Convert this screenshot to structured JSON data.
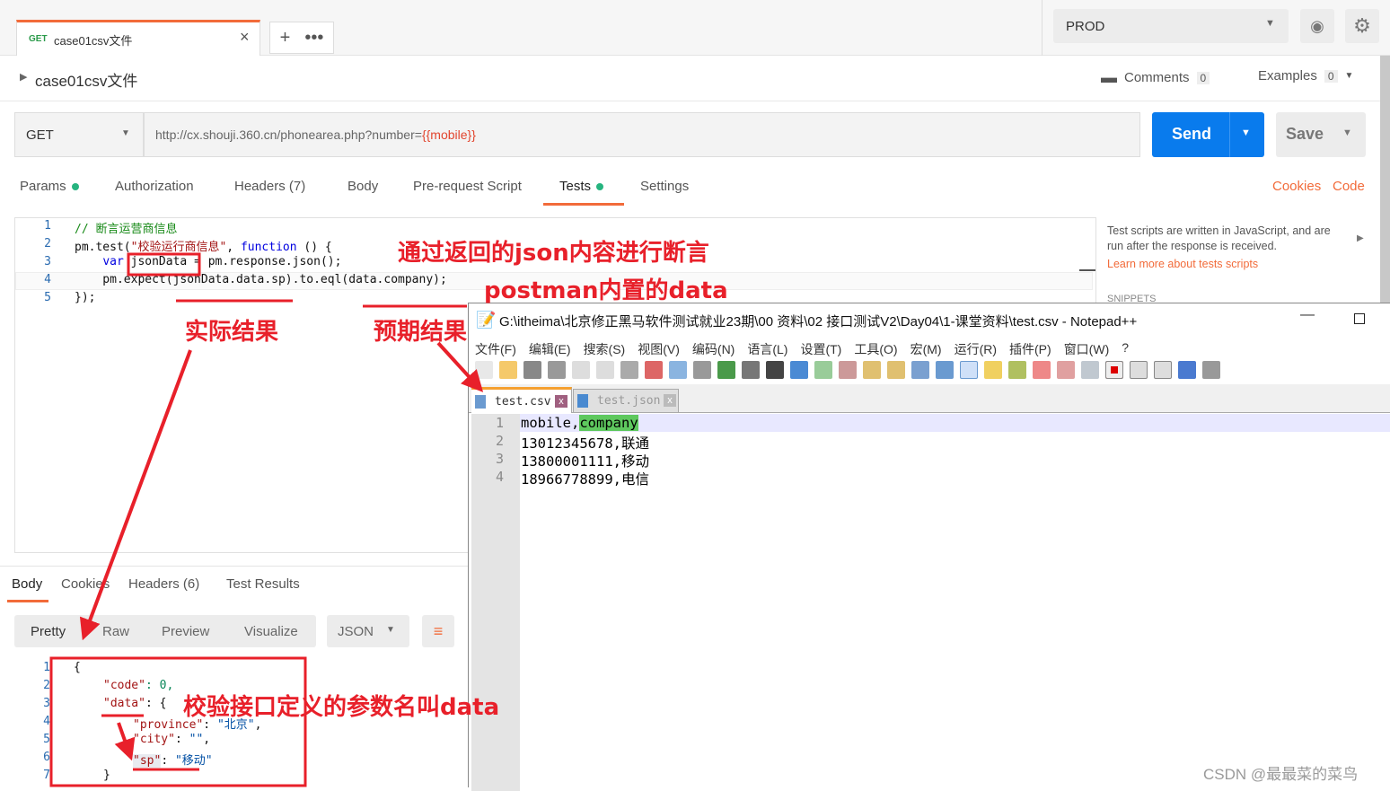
{
  "postman": {
    "request_tab": {
      "method": "GET",
      "name": "case01csv文件"
    },
    "environment": "PROD",
    "breadcrumb": "case01csv文件",
    "comments": {
      "label": "Comments",
      "count": "0"
    },
    "examples": {
      "label": "Examples",
      "count": "0"
    },
    "method": "GET",
    "url_prefix": "http://cx.shouji.360.cn/phonearea.php?number=",
    "url_var": "{{mobile}}",
    "send": "Send",
    "save": "Save",
    "tabs": [
      "Params",
      "Authorization",
      "Headers (7)",
      "Body",
      "Pre-request Script",
      "Tests",
      "Settings"
    ],
    "cookies": "Cookies",
    "code_link": "Code",
    "script_lines": [
      {
        "n": "1",
        "text": "// 断言运营商信息"
      },
      {
        "n": "2",
        "a": "pm.test(",
        "b": "\"校验运行商信息\"",
        "c": ", ",
        "d": "function",
        "e": " () {"
      },
      {
        "n": "3",
        "a": "    ",
        "b": "var",
        "c": " ",
        "d": "jsonData",
        "e": " = pm.response.json();"
      },
      {
        "n": "4",
        "text": "    pm.expect(jsonData.data.sp).to.eql(data.company);"
      },
      {
        "n": "5",
        "text": "});"
      }
    ],
    "side_help": "Test scripts are written in JavaScript, and are run after the response is received.",
    "side_link": "Learn more about tests scripts",
    "snippets": "SNIPPETS",
    "response_tabs": [
      "Body",
      "Cookies",
      "Headers (6)",
      "Test Results"
    ],
    "view_modes": [
      "Pretty",
      "Raw",
      "Preview",
      "Visualize"
    ],
    "format": "JSON",
    "response_lines": [
      {
        "n": "1",
        "text": "{"
      },
      {
        "n": "2",
        "k": "\"code\"",
        "v": ": 0,"
      },
      {
        "n": "3",
        "k": "\"data\"",
        "v": ": {"
      },
      {
        "n": "4",
        "k": "\"province\"",
        "v": "\"北京\""
      },
      {
        "n": "5",
        "k": "\"city\"",
        "v": "\"\""
      },
      {
        "n": "6",
        "k": "\"sp\"",
        "v": "\"移动\""
      },
      {
        "n": "7",
        "text": "}"
      }
    ]
  },
  "notepad": {
    "title": "G:\\itheima\\北京修正黑马软件测试就业23期\\00 资料\\02 接口测试V2\\Day04\\1-课堂资料\\test.csv - Notepad++",
    "menu": [
      "文件(F)",
      "编辑(E)",
      "搜索(S)",
      "视图(V)",
      "编码(N)",
      "语言(L)",
      "设置(T)",
      "工具(O)",
      "宏(M)",
      "运行(R)",
      "插件(P)",
      "窗口(W)",
      "?"
    ],
    "tabs": [
      "test.csv",
      "test.json"
    ],
    "lines": [
      {
        "n": "1",
        "a": "mobile,",
        "b": "company"
      },
      {
        "n": "2",
        "a": "13012345678,联通"
      },
      {
        "n": "3",
        "a": "13800001111,移动"
      },
      {
        "n": "4",
        "a": "18966778899,电信"
      }
    ]
  },
  "annotations": {
    "a1": "通过返回的json内容进行断言",
    "a2": "postman内置的data",
    "a3": "实际结果",
    "a4": "预期结果",
    "a5": "校验接口定义的参数名叫data"
  },
  "watermark": "CSDN @最最菜的菜鸟",
  "colors": {
    "accent": "#f26b3a",
    "send": "#097bed",
    "annotation": "#e8202a"
  }
}
